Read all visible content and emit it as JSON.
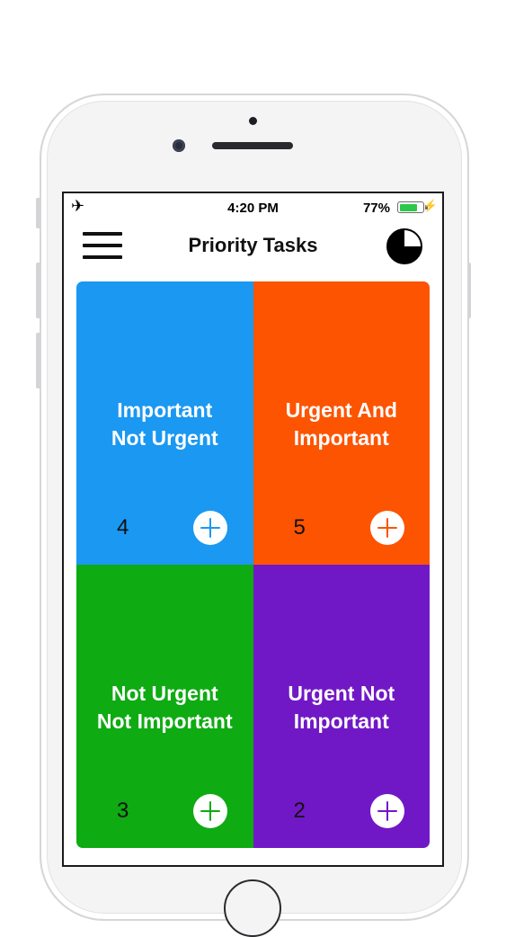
{
  "status_bar": {
    "time": "4:20 PM",
    "battery_percent": "77%",
    "battery_level": 0.77,
    "airplane_icon": "airplane-icon",
    "charging_icon": "bolt-icon"
  },
  "nav": {
    "title": "Priority Tasks",
    "menu_icon": "hamburger-menu-icon",
    "right_icon": "pie-chart-icon"
  },
  "quadrants": [
    {
      "label": "Important\nNot Urgent",
      "count": "4",
      "color": "#1a98f2"
    },
    {
      "label": "Urgent And\nImportant",
      "count": "5",
      "color": "#fd5401"
    },
    {
      "label": "Not Urgent\nNot Important",
      "count": "3",
      "color": "#0eab12"
    },
    {
      "label": "Urgent Not\nImportant",
      "count": "2",
      "color": "#7118c6"
    }
  ]
}
